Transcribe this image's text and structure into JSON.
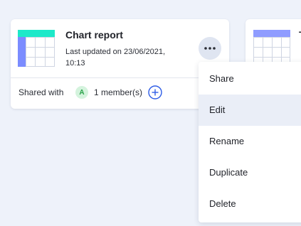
{
  "card": {
    "title": "Chart report",
    "updated": "Last updated on 23/06/2021, 10:13",
    "shared_label": "Shared with",
    "avatar_initial": "A",
    "members": "1 member(s)"
  },
  "card2": {
    "title_partial": "T"
  },
  "menu": {
    "items": [
      {
        "label": "Share"
      },
      {
        "label": "Edit"
      },
      {
        "label": "Rename"
      },
      {
        "label": "Duplicate"
      },
      {
        "label": "Delete"
      }
    ],
    "active_index": 1
  },
  "colors": {
    "background": "#eef2fa",
    "thumb_header_teal": "#1de9c9",
    "thumb_sidebar_blue": "#7b8cff",
    "thumb2_header_blue": "#8f9cff",
    "avatar_bg": "#d4f3dd",
    "avatar_fg": "#2aa34a",
    "add_icon": "#2f5de6",
    "menu_hover": "#eaeef7"
  },
  "icons": {
    "thumbnail": "table-chart-icon",
    "more": "more-horizontal-icon",
    "add": "plus-circle-icon"
  }
}
